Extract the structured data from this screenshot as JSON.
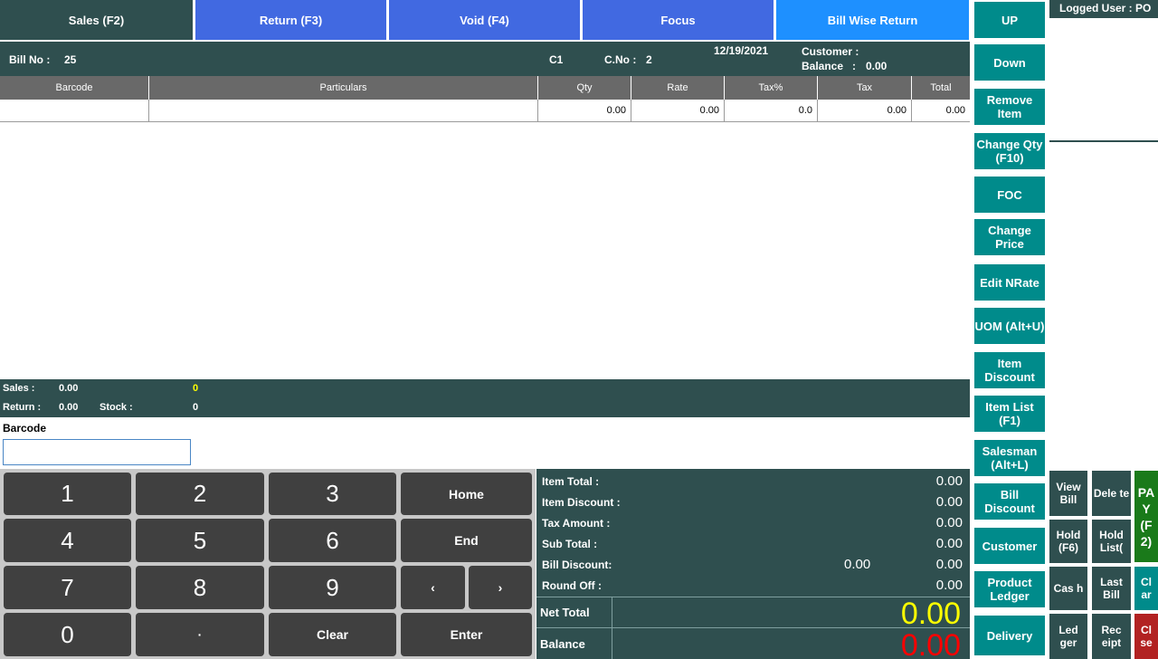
{
  "tabs": {
    "sales": "Sales (F2)",
    "return": "Return (F3)",
    "void": "Void (F4)",
    "focus": "Focus",
    "bill_wise_return": "Bill Wise Return"
  },
  "bill": {
    "bill_no_label": "Bill No :",
    "bill_no": "25",
    "counter": "C1",
    "cno_label": "C.No :",
    "cno": "2",
    "date": "12/19/2021",
    "customer_label": "Customer :",
    "balance_label": "Balance   :",
    "balance": "0.00"
  },
  "grid": {
    "columns": [
      "Barcode",
      "Particulars",
      "Qty",
      "Rate",
      "Tax%",
      "Tax",
      "Total"
    ],
    "row": {
      "barcode": "",
      "particulars": "",
      "qty": "0.00",
      "rate": "0.00",
      "tax_pct": "0.0",
      "tax": "0.00",
      "total": "0.00"
    }
  },
  "status": {
    "sales_label": "Sales :",
    "sales": "0.00",
    "sales_count": "0",
    "return_label": "Return :",
    "return": "0.00",
    "stock_label": "Stock :",
    "stock": "0"
  },
  "barcode": {
    "label": "Barcode",
    "value": "",
    "placeholder": ""
  },
  "keypad": {
    "k1": "1",
    "k2": "2",
    "k3": "3",
    "home": "Home",
    "k4": "4",
    "k5": "5",
    "k6": "6",
    "end": "End",
    "k7": "7",
    "k8": "8",
    "k9": "9",
    "left": "‹",
    "right": "›",
    "k0": "0",
    "dot": "·",
    "clear": "Clear",
    "enter": "Enter"
  },
  "totals": {
    "item_total_label": "Item Total :",
    "item_total": "0.00",
    "item_discount_label": "Item Discount :",
    "item_discount": "0.00",
    "tax_amount_label": "Tax Amount :",
    "tax_amount": "0.00",
    "sub_total_label": "Sub Total :",
    "sub_total": "0.00",
    "bill_discount_label": "Bill Discount:",
    "bill_discount_input": "0.00",
    "bill_discount": "0.00",
    "round_off_label": "Round Off :",
    "round_off": "0.00",
    "net_total_label": "Net Total",
    "net_total": "0.00",
    "balance_label": "Balance",
    "balance": "0.00"
  },
  "side_buttons": {
    "up": "UP",
    "down": "Down",
    "remove_item": "Remove Item",
    "change_qty": "Change Qty (F10)",
    "foc": "FOC",
    "change_price": "Change Price",
    "edit_nrate": "Edit NRate",
    "uom": "UOM (Alt+U)",
    "item_discount": "Item Discount",
    "item_list": "Item List (F1)",
    "salesman": "Salesman (Alt+L)",
    "bill_discount": "Bill Discount",
    "customer": "Customer",
    "product_ledger": "Product Ledger",
    "delivery": "Delivery"
  },
  "user": {
    "logged_user": "Logged User : PO"
  },
  "small_buttons": {
    "view_bill": "View Bill",
    "delete": "Dele te",
    "pay": "PA Y (F 2)",
    "hold": "Hold (F6)",
    "hold_list": "Hold List(",
    "cash": "Cas h",
    "last_bill": "Last Bill",
    "clear_all": "Cl ar",
    "ledger": "Led ger",
    "receipt": "Rec eipt",
    "close": "Cl se"
  },
  "colors": {
    "dark_teal": "#2f4f4f",
    "teal": "#008b8b",
    "royal_blue": "#4169e1",
    "blue": "#1e90ff",
    "net_total": "#ffff00",
    "balance": "#ff0000",
    "pay_green": "#1a7a1a",
    "close_red": "#b22222"
  }
}
